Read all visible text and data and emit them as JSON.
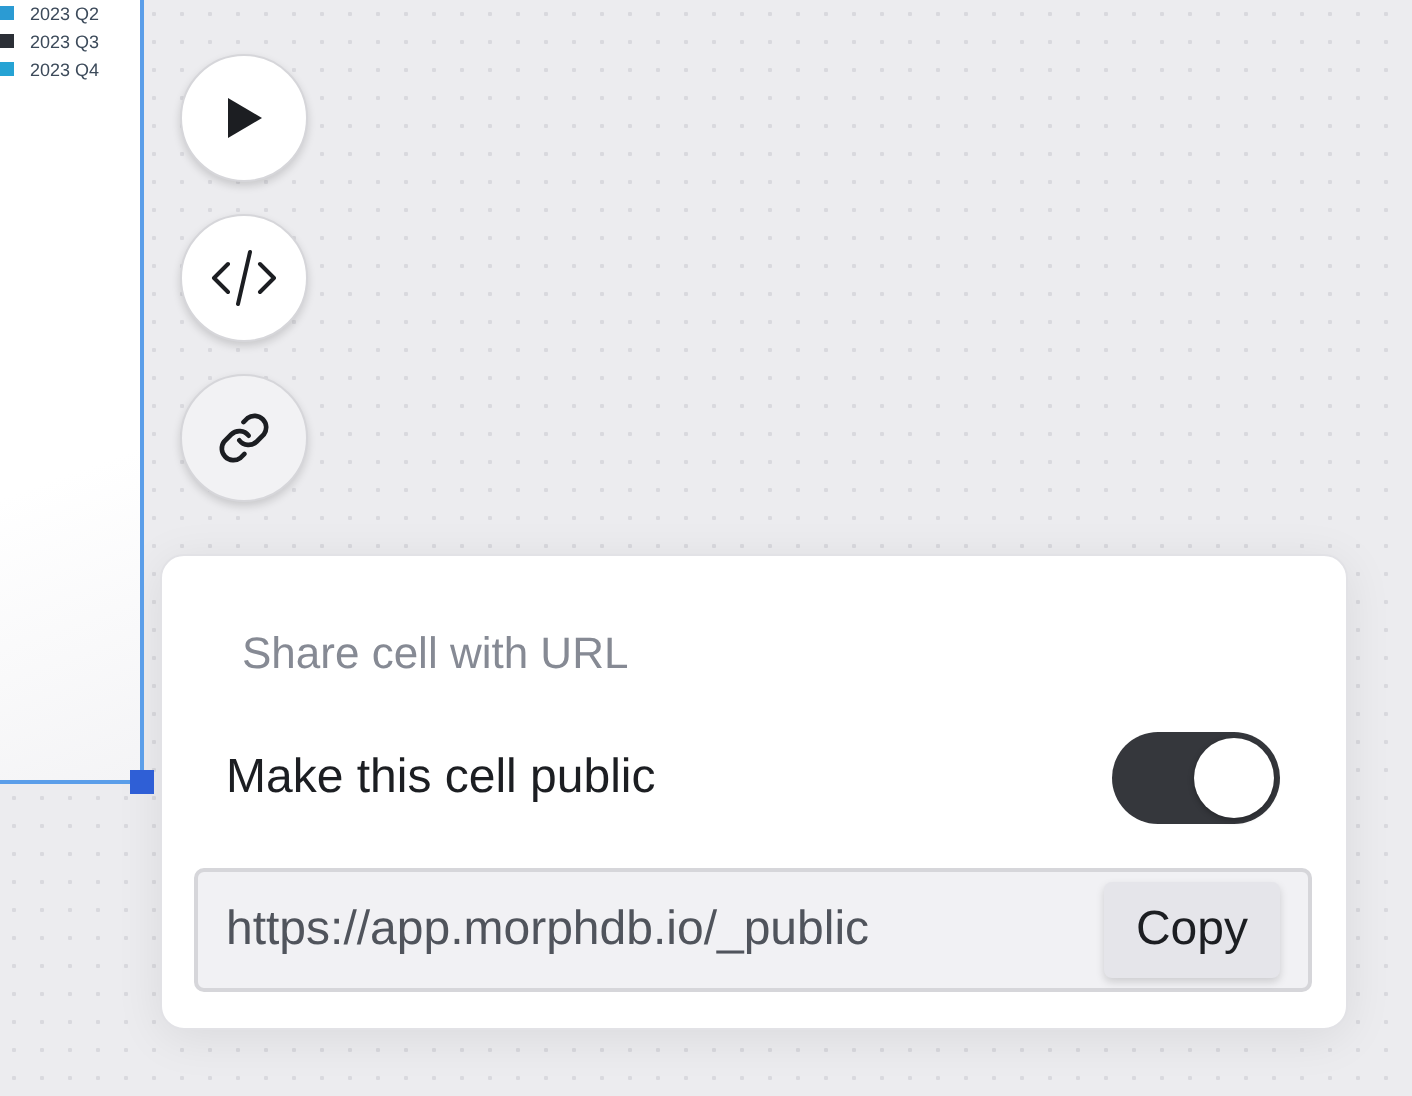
{
  "cell": {
    "legend": [
      {
        "label": "2023 Q2",
        "color": "#2b9bd3"
      },
      {
        "label": "2023 Q3",
        "color": "#2b2f36"
      },
      {
        "label": "2023 Q4",
        "color": "#26a3d4"
      }
    ],
    "selected": true
  },
  "actions": [
    {
      "kind": "run",
      "selected": false
    },
    {
      "kind": "code",
      "selected": false
    },
    {
      "kind": "link",
      "selected": true
    }
  ],
  "share_popover": {
    "title": "Share cell with URL",
    "public_label": "Make this cell public",
    "public": true,
    "url": "https://app.morphdb.io/_public",
    "copy_button": "Copy"
  }
}
